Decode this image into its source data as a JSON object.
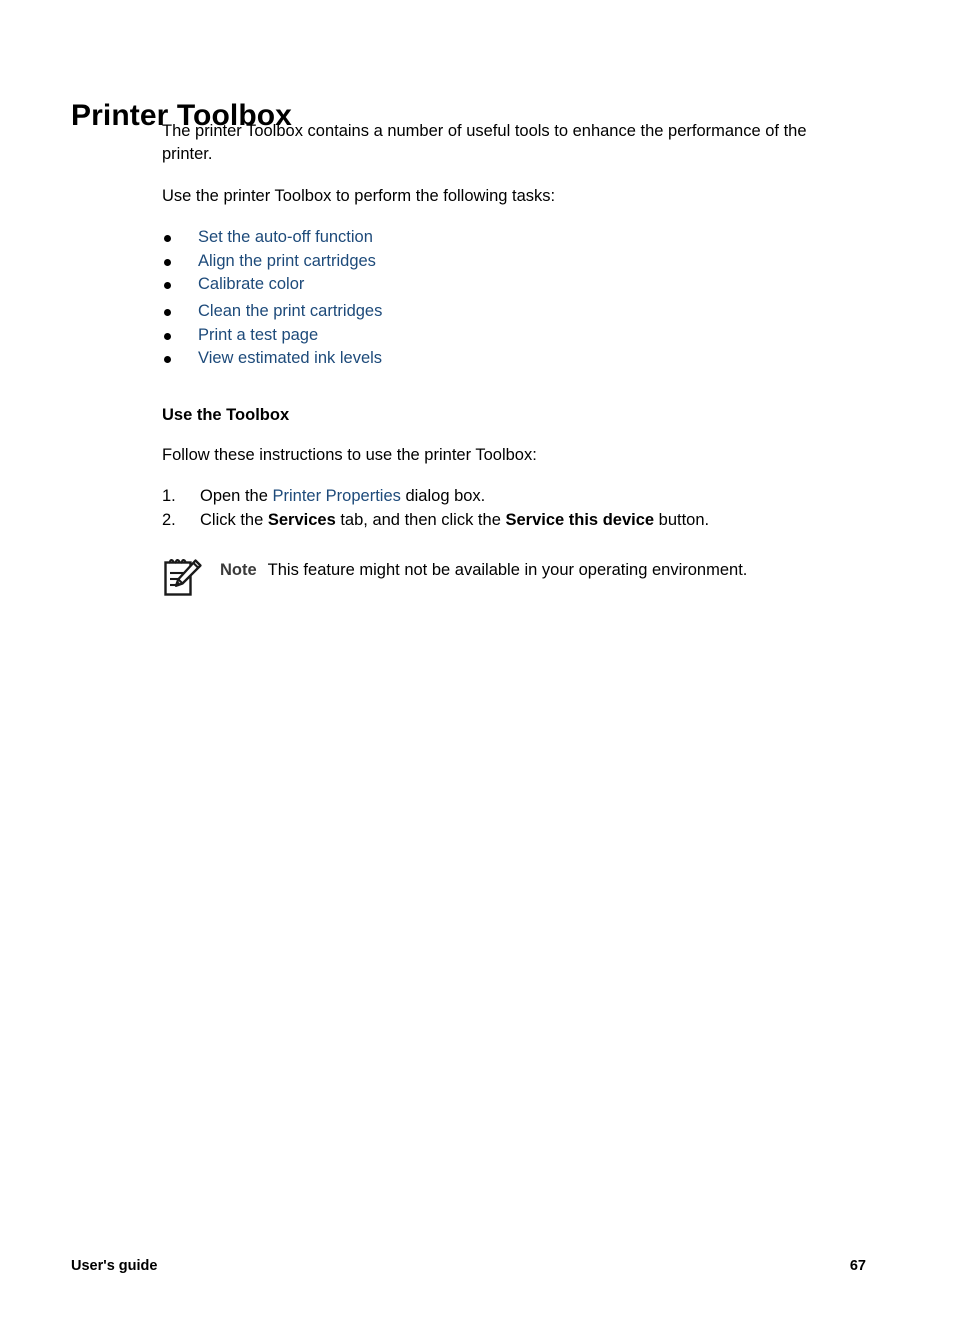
{
  "document": {
    "title": "Printer Toolbox",
    "intro_paragraphs": [
      "The printer Toolbox contains a number of useful tools to enhance the performance of the printer.",
      "Use the printer Toolbox to perform the following tasks:"
    ],
    "task_links": [
      "Set the auto-off function",
      "Align the print cartridges",
      "Calibrate color",
      "Clean the print cartridges",
      "Print a test page",
      "View estimated ink levels"
    ],
    "section": {
      "heading": "Use the Toolbox",
      "lead": "Follow these instructions to use the printer Toolbox:",
      "steps": [
        {
          "number": "1.",
          "prefix": "Open the ",
          "link": "Printer Properties",
          "suffix": " dialog box."
        },
        {
          "number": "2.",
          "prefix": "Click the ",
          "bold1": "Services",
          "middle": " tab, and then click the ",
          "bold2": "Service this device",
          "suffix": " button."
        }
      ]
    },
    "note": {
      "icon": "notepad-pencil-icon",
      "label": "Note",
      "text": "This feature might not be available in your operating environment."
    }
  },
  "footer": {
    "left": "User's guide",
    "page_number": "67"
  },
  "colors": {
    "link": "#1d4a7a",
    "text": "#000000",
    "note_label": "#3b3b3b",
    "page_background": "#ffffff"
  }
}
